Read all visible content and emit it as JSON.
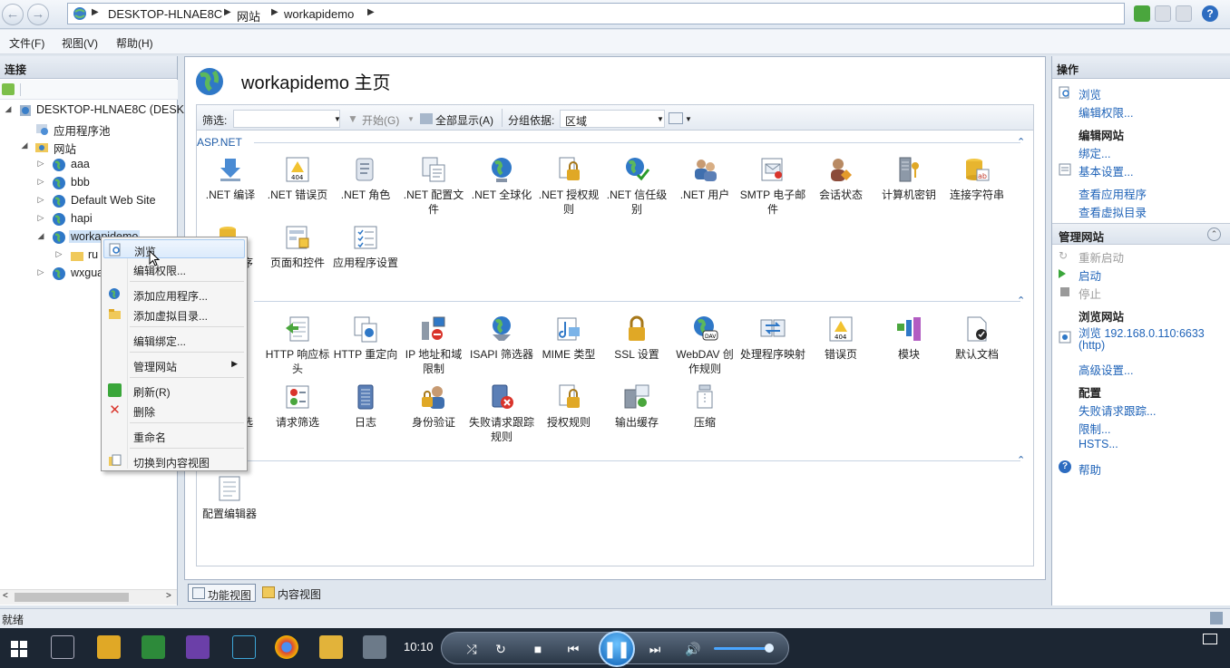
{
  "address": {
    "crumbs": [
      "DESKTOP-HLNAE8C",
      "网站",
      "workapidemo"
    ]
  },
  "menubar": {
    "file": "文件(F)",
    "view": "视图(V)",
    "help": "帮助(H)"
  },
  "left": {
    "title": "连接",
    "tree": {
      "server": "DESKTOP-HLNAE8C (DESK",
      "apppools": "应用程序池",
      "sites": "网站",
      "site_aaa": "aaa",
      "site_bbb": "bbb",
      "site_default": "Default Web Site",
      "site_hapi": "hapi",
      "site_workapidemo": "workapidemo",
      "child_ru": "ru",
      "site_wxgua": "wxgua"
    }
  },
  "center": {
    "title": "workapidemo 主页",
    "filter_label": "筛选:",
    "filter_value": "",
    "start": "开始(G)",
    "show_all": "全部显示(A)",
    "group_by_label": "分组依据:",
    "group_by_value": "区域",
    "group_aspnet": "ASP.NET",
    "aspnet_features": [
      ".NET 编译",
      ".NET 错误页",
      ".NET 角色",
      ".NET 配置文件",
      ".NET 全球化",
      ".NET 授权规则",
      ".NET 信任级别",
      ".NET 用户",
      "SMTP 电子邮件",
      "会话状态",
      "计算机密钥",
      "连接字符串"
    ],
    "aspnet_row2": [
      "序",
      "页面和控件",
      "应用程序设置"
    ],
    "iis_features": [
      "HTTP 响应标头",
      "HTTP 重定向",
      "IP 地址和域限制",
      "ISAPI 筛选器",
      "MIME 类型",
      "SSL 设置",
      "WebDAV 创作规则",
      "处理程序映射",
      "错误页",
      "模块",
      "默认文档"
    ],
    "iis_row2": [
      "选",
      "请求筛选",
      "日志",
      "身份验证",
      "失败请求跟踪规则",
      "授权规则",
      "输出缓存",
      "压缩"
    ],
    "mgmt_features": [
      "配置编辑器"
    ]
  },
  "viewtabs": {
    "features": "功能视图",
    "content": "内容视图"
  },
  "right": {
    "title": "操作",
    "browse": "浏览",
    "edit_perms": "编辑权限...",
    "edit_site_hdr": "编辑网站",
    "bindings": "绑定...",
    "basic_settings": "基本设置...",
    "view_apps": "查看应用程序",
    "view_vdirs": "查看虚拟目录",
    "manage_site_hdr": "管理网站",
    "restart": "重新启动",
    "start": "启动",
    "stop": "停止",
    "browse_site_hdr": "浏览网站",
    "browse_url": "浏览 192.168.0.110:6633",
    "browse_proto": "(http)",
    "advanced": "高级设置...",
    "config_hdr": "配置",
    "failed_tracing": "失败请求跟踪...",
    "limits": "限制...",
    "hsts": "HSTS...",
    "help": "帮助"
  },
  "status": "就绪",
  "context_menu": {
    "browse": "浏览",
    "edit_perms": "编辑权限...",
    "add_app": "添加应用程序...",
    "add_vdir": "添加虚拟目录...",
    "edit_bindings": "编辑绑定...",
    "manage_site": "管理网站",
    "refresh": "刷新(R)",
    "delete": "删除",
    "rename": "重命名",
    "switch_content": "切换到内容视图"
  },
  "taskbar": {
    "clock": "10:10"
  },
  "colors": {
    "link": "#1f63b8",
    "accent": "#1f5ca7",
    "taskbar": "#1c2633"
  }
}
